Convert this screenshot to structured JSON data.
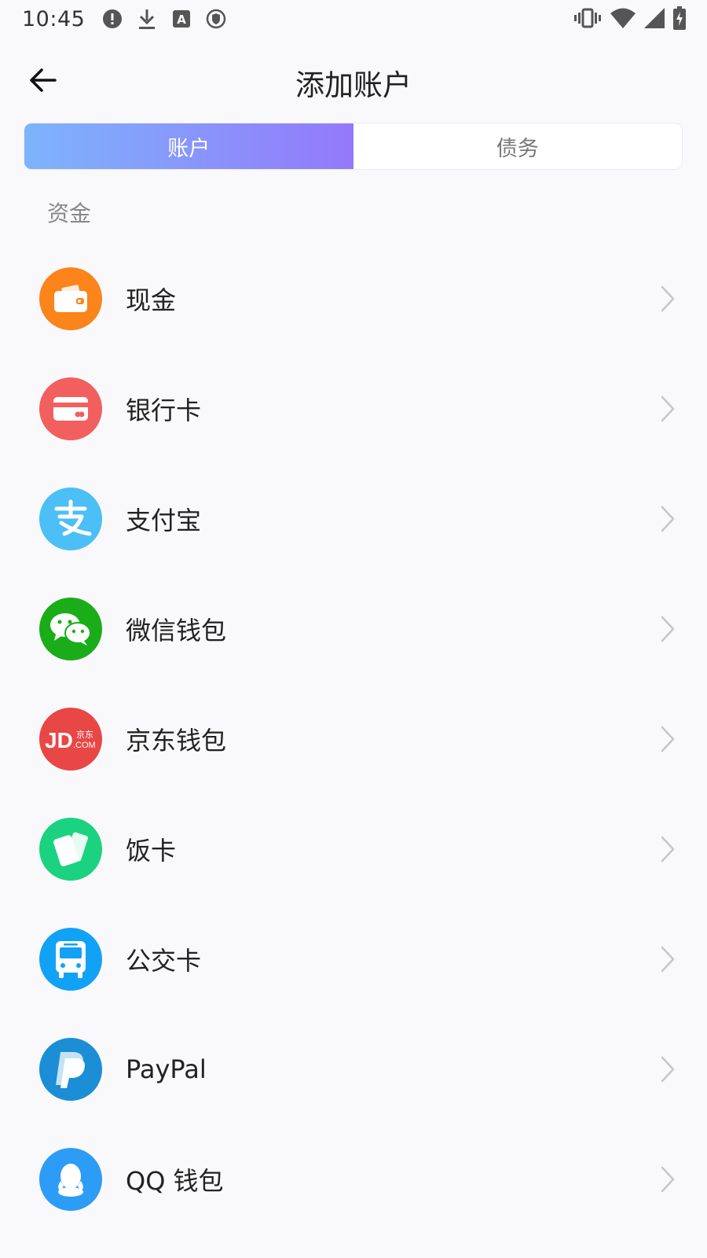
{
  "status_bar": {
    "time": "10:45",
    "left_icons": [
      "alert-icon",
      "download-icon",
      "a-icon",
      "shield-icon"
    ],
    "right_icons": [
      "vibrate-icon",
      "wifi-icon",
      "cell-signal-icon",
      "battery-charging-icon"
    ]
  },
  "app_bar": {
    "back_icon": "arrow-left-icon",
    "title": "添加账户"
  },
  "tabs": [
    {
      "label": "账户",
      "active": true
    },
    {
      "label": "债务",
      "active": false
    }
  ],
  "colors": {
    "tab_gradient_start": "#7db4fb",
    "tab_gradient_end": "#9479fb",
    "cash": "#fb841b",
    "bank_card": "#f25f5f",
    "alipay": "#4bbff6",
    "wechat": "#1aad19",
    "jd": "#e94646",
    "meal_card": "#1ad27f",
    "bus_card": "#12a2f5",
    "paypal": "#1b8ed5",
    "qq": "#2d9cf6"
  },
  "section": {
    "title": "资金"
  },
  "accounts": [
    {
      "label": "现金",
      "icon": "wallet-icon"
    },
    {
      "label": "银行卡",
      "icon": "credit-card-icon"
    },
    {
      "label": "支付宝",
      "icon": "alipay-icon"
    },
    {
      "label": "微信钱包",
      "icon": "wechat-icon"
    },
    {
      "label": "京东钱包",
      "icon": "jd-icon",
      "icon_text_main": "JD",
      "icon_text_sub_top": "京东",
      "icon_text_sub_bottom": ".COM"
    },
    {
      "label": "饭卡",
      "icon": "meal-card-icon"
    },
    {
      "label": "公交卡",
      "icon": "bus-icon"
    },
    {
      "label": "PayPal",
      "icon": "paypal-icon"
    },
    {
      "label": "QQ 钱包",
      "icon": "qq-icon"
    }
  ]
}
